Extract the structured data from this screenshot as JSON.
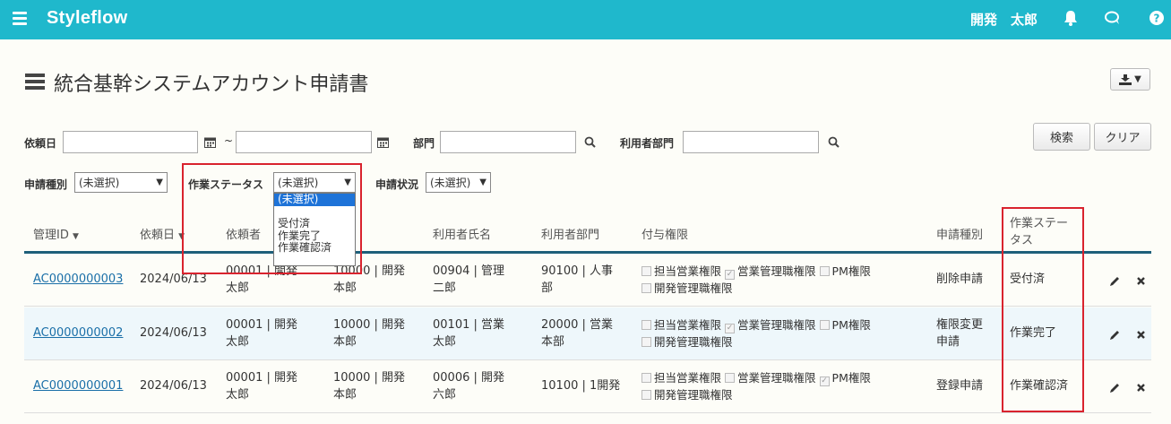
{
  "app": {
    "brand": "Styleflow",
    "user": "開発　太郎",
    "icons": [
      "menu-icon",
      "bell-icon",
      "chat-icon",
      "help-icon"
    ]
  },
  "page": {
    "title": "統合基幹システムアカウント申請書"
  },
  "filters": {
    "request_date_label": "依頼日",
    "range_sep": "~",
    "dept_label": "部門",
    "user_dept_label": "利用者部門",
    "search_label": "検索",
    "clear_label": "クリア",
    "request_type_label": "申請種別",
    "request_type_value": "(未選択)",
    "work_status_label": "作業ステータス",
    "work_status_value": "(未選択)",
    "apply_status_label": "申請状況",
    "apply_status_value": "(未選択)"
  },
  "work_status_options": [
    "(未選択)",
    "",
    "受付済",
    "作業完了",
    "作業確認済"
  ],
  "table": {
    "headers": {
      "id": "管理ID",
      "date": "依頼日",
      "requester": "依頼者",
      "user_name": "利用者氏名",
      "user_dept": "利用者部門",
      "perms": "付与権限",
      "type": "申請種別",
      "status": "作業ステー\nタス"
    },
    "perm_labels": [
      "担当営業権限",
      "営業管理職権限",
      "PM権限",
      "開発管理職権限"
    ],
    "rows": [
      {
        "id": "AC0000000003",
        "date": "2024/06/13",
        "requester": "00001 | 開発\n太郎",
        "approver": "10000 | 開発\n本郎",
        "user_name": "00904 | 管理\n二郎",
        "user_dept": "90100 | 人事\n部",
        "type": "削除申請",
        "status": "受付済",
        "perms": [
          false,
          true,
          false,
          false
        ]
      },
      {
        "id": "AC0000000002",
        "date": "2024/06/13",
        "requester": "00001 | 開発\n太郎",
        "approver": "10000 | 開発\n本郎",
        "user_name": "00101 | 営業\n太郎",
        "user_dept": "20000 | 営業\n本部",
        "type": "権限変更\n申請",
        "status": "作業完了",
        "perms": [
          false,
          true,
          false,
          false
        ]
      },
      {
        "id": "AC0000000001",
        "date": "2024/06/13",
        "requester": "00001 | 開発\n太郎",
        "approver": "10000 | 開発\n本郎",
        "user_name": "00006 | 開発\n六郎",
        "user_dept": "10100 | 1開発",
        "type": "登録申請",
        "status": "作業確認済",
        "perms": [
          false,
          false,
          true,
          false
        ]
      }
    ]
  },
  "colors": {
    "topbar": "#1fb8cc",
    "highlight": "#d9232e",
    "link": "#1a6fa8"
  }
}
